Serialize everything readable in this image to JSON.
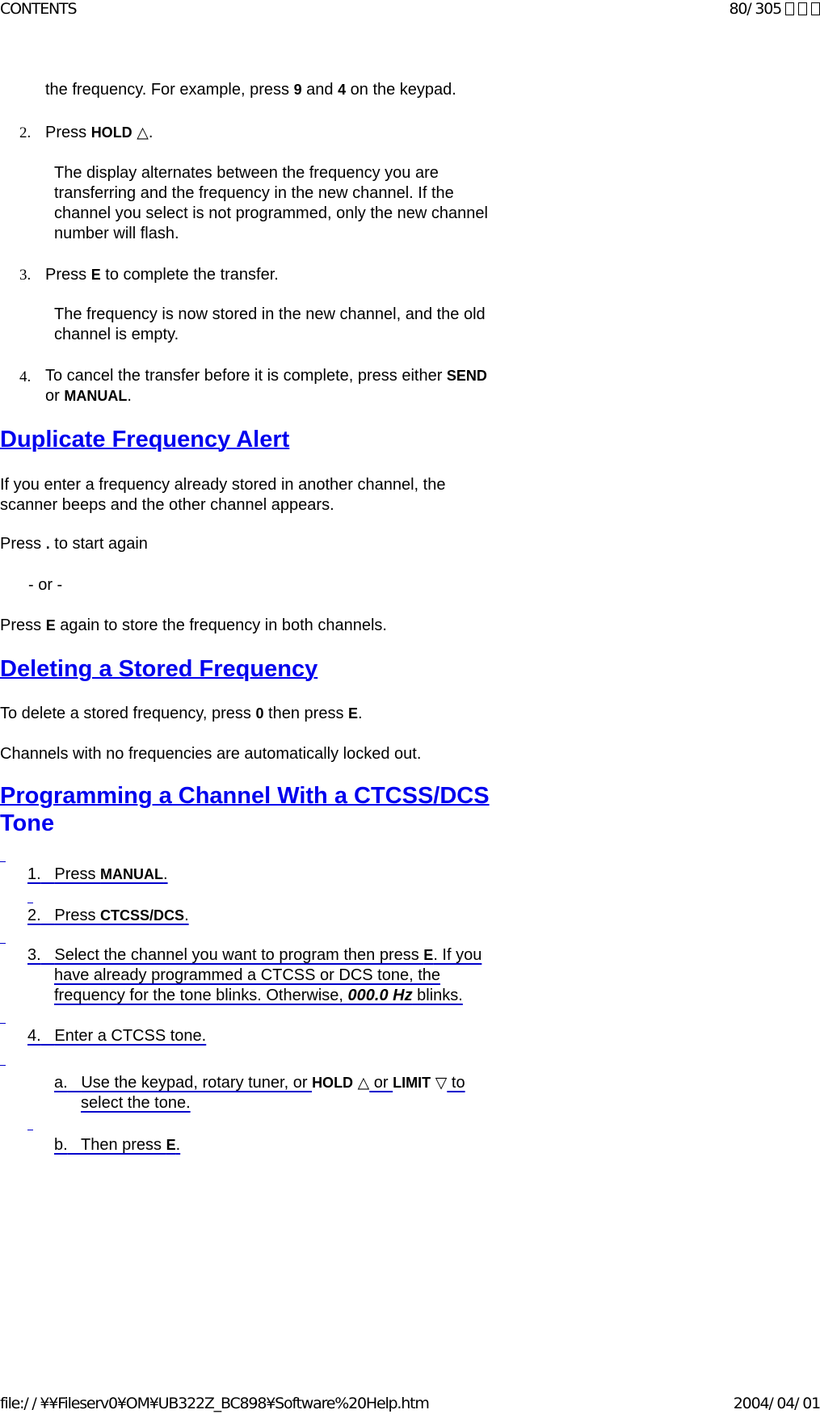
{
  "header": {
    "left": "CONTENTS",
    "page_indicator": "80/ 305",
    "glyph_boxes": 3
  },
  "footer": {
    "path": "file:/ / ¥¥Fileserv0¥OM¥UB322Z_BC898¥Software%20Help.htm",
    "date": "2004/ 04/ 01"
  },
  "transfer_steps": {
    "cont_line": {
      "pre": "the frequency. For example, press ",
      "k1": "9",
      "mid": " and ",
      "k2": "4",
      "post": " on the keypad."
    },
    "step2": {
      "num": "2.",
      "pre": "Press ",
      "key": "HOLD",
      "icon": "△",
      "post": "."
    },
    "step2_note": [
      "The display alternates between the frequency you are",
      "transferring and the frequency in the new channel. If the",
      "channel you select is not programmed, only the new channel",
      "number will flash."
    ],
    "step3": {
      "num": "3.",
      "pre": "Press ",
      "key": "E",
      "post": " to complete the transfer."
    },
    "step3_note": [
      "The frequency is now stored in the new channel, and the old",
      "channel is empty."
    ],
    "step4": {
      "num": "4.",
      "pre": "To cancel the transfer before it is complete, press either ",
      "key1": "SEND",
      "mid": "or ",
      "key2": "MANUAL",
      "post": "."
    }
  },
  "duplicate": {
    "heading": "Duplicate Frequency Alert",
    "para1": [
      "If you enter a frequency already stored in another channel, the",
      "scanner beeps and the other channel appears."
    ],
    "press_dot": {
      "pre": "Press ",
      "key": ".",
      "post": " to start again"
    },
    "or": "- or -",
    "press_e": {
      "pre": "Press ",
      "key": "E",
      "post": " again to store the frequency in both channels."
    }
  },
  "deleting": {
    "heading": "Deleting a Stored Frequency",
    "line1": {
      "pre": "To delete a stored frequency, press ",
      "k1": "0",
      "mid": " then press ",
      "k2": "E",
      "post": "."
    },
    "line2": "Channels with no frequencies are automatically locked out."
  },
  "programming": {
    "heading_line1": "Programming a Channel With a CTCSS/DCS",
    "heading_line2": "Tone",
    "step1": {
      "num": "1.",
      "pre": "Press ",
      "key": "MANUAL",
      "post": "."
    },
    "step2": {
      "num": "2.",
      "pre": "Press ",
      "key": "CTCSS/DCS",
      "post": "."
    },
    "step3": {
      "num": "3.",
      "line1_pre": "Select the channel you want to program then press ",
      "key": "E",
      "line1_post": ". If you",
      "line2": "have already programmed a CTCSS or DCS tone, the",
      "line3_pre": "frequency for the tone blinks.  Otherwise, ",
      "value": "000.0 Hz",
      "line3_post": " blinks."
    },
    "step4": {
      "num": "4.",
      "text": "Enter a CTCSS tone."
    },
    "step4a": {
      "num": "a.",
      "pre": "Use the keypad, rotary tuner, or ",
      "key1": "HOLD",
      "icon1": "△",
      "mid": " or ",
      "key2": "LIMIT",
      "icon2": "▽",
      "post": " to",
      "line2": "select the tone."
    },
    "step4b": {
      "num": "b.",
      "pre": "Then press ",
      "key": "E",
      "post": "."
    }
  }
}
